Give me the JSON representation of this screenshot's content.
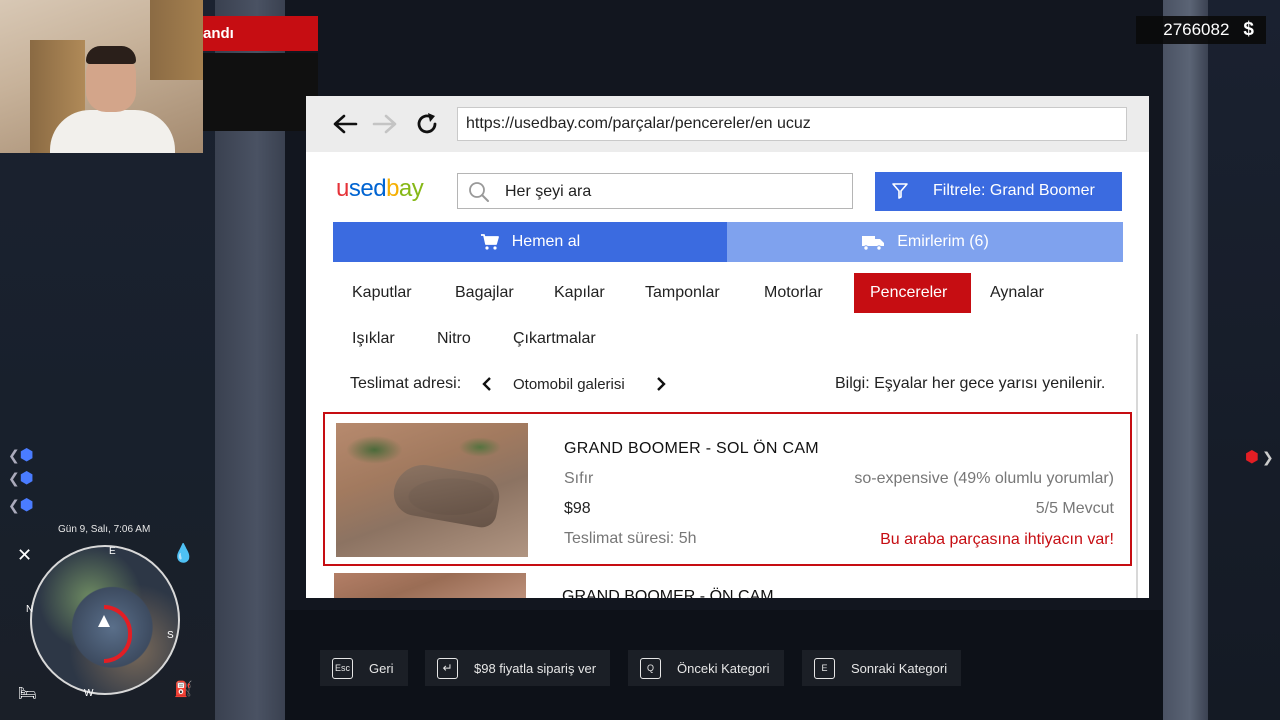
{
  "game_hud": {
    "money": "2766082",
    "currency_symbol": "$",
    "banner_text": "andı",
    "date_time": "Gün 9, Salı, 7:06 AM",
    "compass": {
      "n": "N",
      "e": "E",
      "s": "S",
      "w": "W"
    }
  },
  "browser": {
    "url": "https://usedbay.com/parçalar/pencereler/en ucuz"
  },
  "site": {
    "logo": {
      "p1": "u",
      "p2": "sed",
      "p3": "b",
      "p4": "ay"
    },
    "search_placeholder": "Her şeyi ara",
    "filter_label": "Filtrele: Grand Boomer",
    "tabs": {
      "buy": "Hemen al",
      "orders": "Emirlerim (6)"
    },
    "categories": [
      "Kaputlar",
      "Bagajlar",
      "Kapılar",
      "Tamponlar",
      "Motorlar",
      "Pencereler",
      "Aynalar",
      "Işıklar",
      "Nitro",
      "Çıkartmalar"
    ],
    "active_category": "Pencereler",
    "delivery_label": "Teslimat adresi:",
    "delivery_value": "Otomobil galerisi",
    "info_text": "Bilgi: Eşyalar her gece yarısı yenilenir."
  },
  "listings": [
    {
      "title": "GRAND BOOMER - SOL ÖN CAM",
      "condition": "Sıfır",
      "price": "$98",
      "delivery": "Teslimat süresi: 5h",
      "seller": "so-expensive (49% olumlu yorumlar)",
      "stock": "5/5 Mevcut",
      "need": "Bu araba parçasına ihtiyacın var!"
    },
    {
      "title": "GRAND BOOMER - ÖN CAM"
    }
  ],
  "hints": [
    {
      "key": "Esc",
      "label": "Geri"
    },
    {
      "key": "↵",
      "label": "$98 fiyatla sipariş ver"
    },
    {
      "key": "Q",
      "label": "Önceki Kategori"
    },
    {
      "key": "E",
      "label": "Sonraki Kategori"
    }
  ],
  "colors": {
    "accent_blue": "#3b6be0",
    "light_blue": "#7fa2ee",
    "active_red": "#c60d12"
  }
}
